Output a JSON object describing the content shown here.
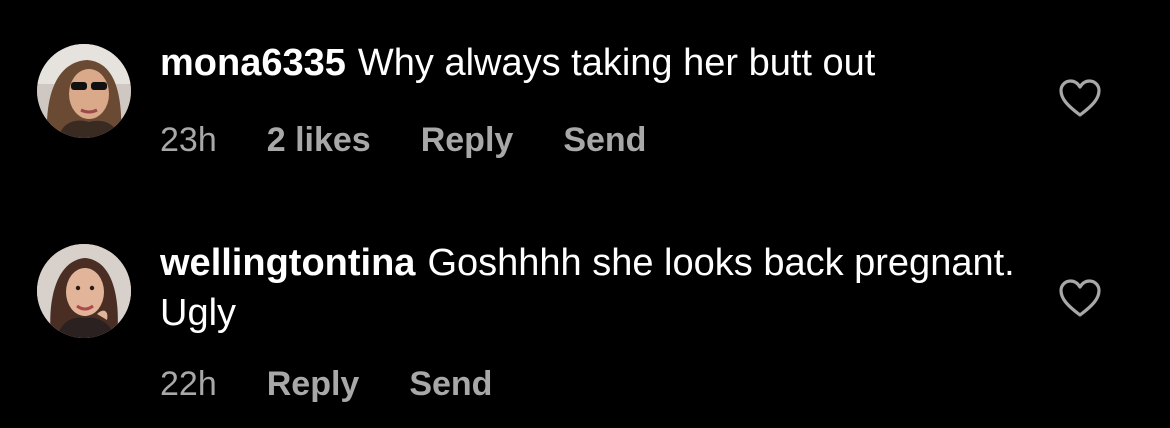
{
  "comments": [
    {
      "username": "mona6335",
      "text": "Why always taking her butt out",
      "time": "23h",
      "likes": "2 likes",
      "reply_label": "Reply",
      "send_label": "Send",
      "avatar_icon": "profile-photo",
      "like_icon": "heart-outline-icon"
    },
    {
      "username": "wellingtontina",
      "text": "Goshhhh she looks back pregnant.  Ugly",
      "time": "22h",
      "reply_label": "Reply",
      "send_label": "Send",
      "avatar_icon": "profile-photo",
      "like_icon": "heart-outline-icon"
    }
  ],
  "colors": {
    "background": "#000000",
    "primary_text": "#ffffff",
    "secondary_text": "#a8a8a8"
  }
}
